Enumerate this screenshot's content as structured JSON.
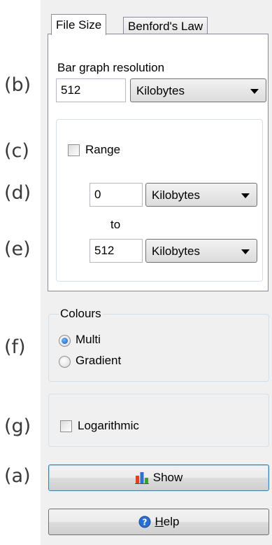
{
  "annotations": {
    "b": "(b)",
    "c": "(c)",
    "d": "(d)",
    "e": "(e)",
    "f": "(f)",
    "g": "(g)",
    "a": "(a)"
  },
  "tabs": {
    "file_size": "File Size",
    "benford": "Benford's Law"
  },
  "resolution": {
    "label": "Bar graph resolution",
    "value": "512",
    "unit": "Kilobytes"
  },
  "range": {
    "label": "Range",
    "checked": false,
    "from_value": "0",
    "from_unit": "Kilobytes",
    "to_label": "to",
    "to_value": "512",
    "to_unit": "Kilobytes"
  },
  "colours": {
    "title": "Colours",
    "options": [
      "Multi",
      "Gradient"
    ],
    "selected": "Multi"
  },
  "logarithmic": {
    "label": "Logarithmic",
    "checked": false
  },
  "buttons": {
    "show": "Show",
    "help_first": "H",
    "help_rest": "elp"
  },
  "colors": {
    "chart_icon_red": "#e0402c",
    "chart_icon_blue": "#2f6fd0",
    "chart_icon_green": "#2fa62f",
    "help_icon": "#2a6fd0"
  },
  "icons": {
    "show": "bar-chart-icon",
    "help": "help-icon"
  }
}
